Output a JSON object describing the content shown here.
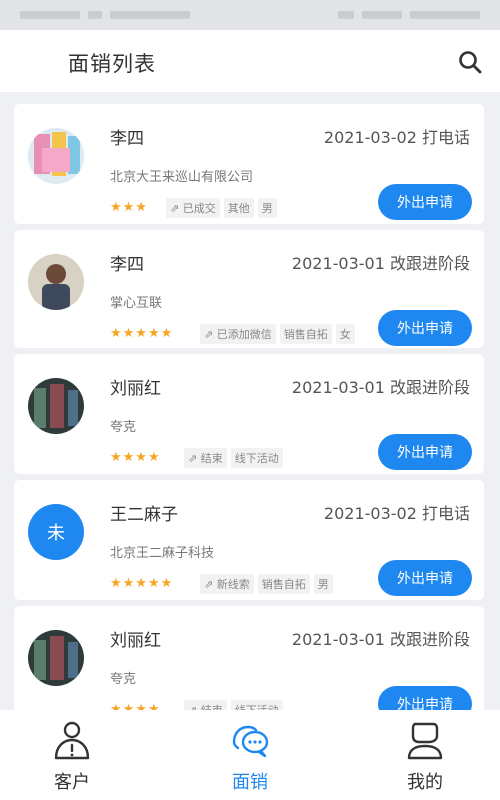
{
  "header": {
    "title": "面销列表"
  },
  "colors": {
    "accent": "#1e88f0",
    "star": "#f5a623",
    "background": "#eef0f3"
  },
  "cards": [
    {
      "name": "李四",
      "meta": "2021-03-02 打电话",
      "company": "北京大王来巡山有限公司",
      "stars": "★★★",
      "tags": [
        "已成交",
        "其他",
        "男"
      ],
      "action": "外出申请",
      "avatar_letter": ""
    },
    {
      "name": "李四",
      "meta": "2021-03-01 改跟进阶段",
      "company": "掌心互联",
      "stars": "★★★★★",
      "tags": [
        "已添加微信",
        "销售自拓",
        "女"
      ],
      "action": "外出申请",
      "avatar_letter": ""
    },
    {
      "name": "刘丽红",
      "meta": "2021-03-01 改跟进阶段",
      "company": "夸克",
      "stars": "★★★★",
      "tags": [
        "结束",
        "线下活动"
      ],
      "action": "外出申请",
      "avatar_letter": ""
    },
    {
      "name": "王二麻子",
      "meta": "2021-03-02 打电话",
      "company": "北京王二麻子科技",
      "stars": "★★★★★",
      "tags": [
        "新线索",
        "销售自拓",
        "男"
      ],
      "action": "外出申请",
      "avatar_letter": "未"
    },
    {
      "name": "刘丽红",
      "meta": "2021-03-01 改跟进阶段",
      "company": "夸克",
      "stars": "★★★★",
      "tags": [
        "结束",
        "线下活动"
      ],
      "action": "外出申请",
      "avatar_letter": ""
    }
  ],
  "tabs": [
    {
      "label": "客户",
      "icon": "person-alert-icon"
    },
    {
      "label": "面销",
      "icon": "chat-bubbles-icon",
      "active": true
    },
    {
      "label": "我的",
      "icon": "user-profile-icon"
    }
  ]
}
